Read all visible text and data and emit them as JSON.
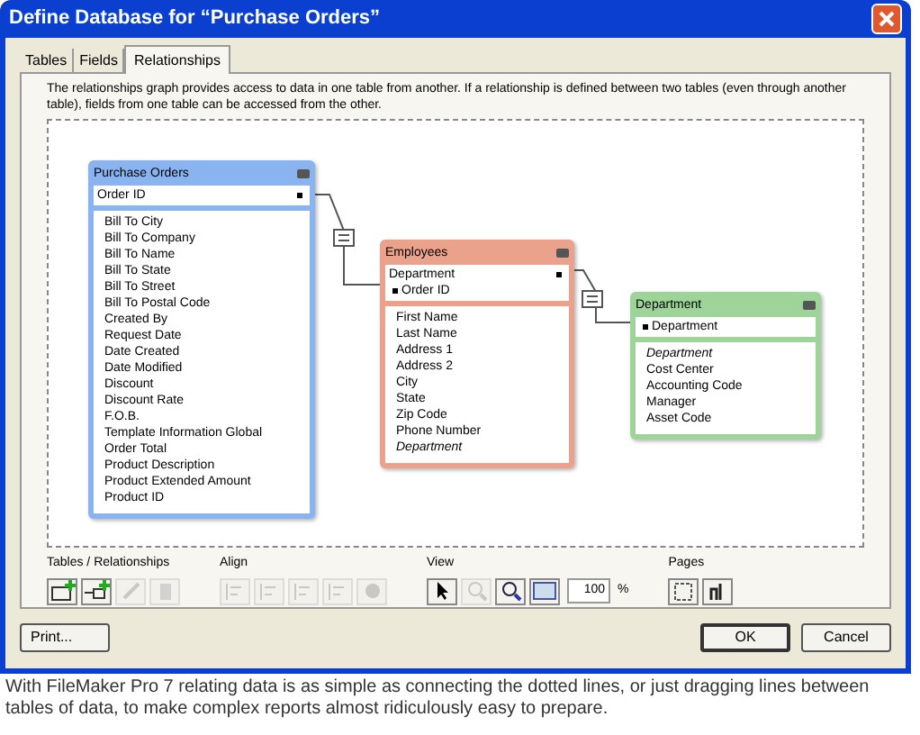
{
  "window": {
    "title": "Define Database for “Purchase Orders”"
  },
  "tabs": [
    {
      "label": "Tables",
      "selected": false
    },
    {
      "label": "Fields",
      "selected": false
    },
    {
      "label": "Relationships",
      "selected": true
    }
  ],
  "description": "The relationships graph provides access to data in one table from another. If a relationship is defined between two tables (even through another table), fields from one table can be accessed from the other.",
  "tables": [
    {
      "name": "Purchase Orders",
      "color": "#8ab4f0",
      "keys": [
        {
          "name": "Order ID",
          "kind": "right-link"
        }
      ],
      "fields": [
        {
          "name": "Bill To City",
          "italic": false
        },
        {
          "name": "Bill To Company",
          "italic": false
        },
        {
          "name": "Bill To Name",
          "italic": false
        },
        {
          "name": "Bill To State",
          "italic": false
        },
        {
          "name": "Bill To Street",
          "italic": false
        },
        {
          "name": "Bill To Postal Code",
          "italic": false
        },
        {
          "name": "Created By",
          "italic": false
        },
        {
          "name": "Request Date",
          "italic": false
        },
        {
          "name": "Date Created",
          "italic": false
        },
        {
          "name": "Date Modified",
          "italic": false
        },
        {
          "name": "Discount",
          "italic": false
        },
        {
          "name": "Discount Rate",
          "italic": false
        },
        {
          "name": "F.O.B.",
          "italic": false
        },
        {
          "name": "Template Information Global",
          "italic": false
        },
        {
          "name": "Order Total",
          "italic": false
        },
        {
          "name": "Product Description",
          "italic": false
        },
        {
          "name": "Product Extended Amount",
          "italic": false
        },
        {
          "name": "Product ID",
          "italic": false
        }
      ]
    },
    {
      "name": "Employees",
      "color": "#eaa28c",
      "keys": [
        {
          "name": "Department",
          "kind": "right-link"
        },
        {
          "name": "Order ID",
          "kind": "left-link"
        }
      ],
      "fields": [
        {
          "name": "First Name",
          "italic": false
        },
        {
          "name": "Last Name",
          "italic": false
        },
        {
          "name": "Address 1",
          "italic": false
        },
        {
          "name": "Address 2",
          "italic": false
        },
        {
          "name": "City",
          "italic": false
        },
        {
          "name": "State",
          "italic": false
        },
        {
          "name": "Zip Code",
          "italic": false
        },
        {
          "name": "Phone Number",
          "italic": false
        },
        {
          "name": "Department",
          "italic": true
        }
      ]
    },
    {
      "name": "Department",
      "color": "#9ed49a",
      "keys": [
        {
          "name": "Department",
          "kind": "left-link"
        }
      ],
      "fields": [
        {
          "name": "Department",
          "italic": true
        },
        {
          "name": "Cost Center",
          "italic": false
        },
        {
          "name": "Accounting Code",
          "italic": false
        },
        {
          "name": "Manager",
          "italic": false
        },
        {
          "name": "Asset Code",
          "italic": false
        }
      ]
    }
  ],
  "toolbar": [
    {
      "label": "Tables / Relationships",
      "buttons": [
        {
          "kind": "add-table",
          "disabled": false
        },
        {
          "kind": "add-relationship",
          "disabled": false
        },
        {
          "kind": "edit",
          "disabled": true
        },
        {
          "kind": "delete",
          "disabled": true
        }
      ]
    },
    {
      "label": "Align",
      "buttons": [
        {
          "kind": "align-left",
          "disabled": true
        },
        {
          "kind": "align-center",
          "disabled": true
        },
        {
          "kind": "align-top",
          "disabled": true
        },
        {
          "kind": "align-bottom",
          "disabled": true
        },
        {
          "kind": "color",
          "disabled": true
        }
      ]
    },
    {
      "label": "View",
      "buttons": [
        {
          "kind": "pointer",
          "disabled": false
        },
        {
          "kind": "zoom-in",
          "disabled": true
        },
        {
          "kind": "zoom-out",
          "disabled": false
        },
        {
          "kind": "fit",
          "disabled": false
        }
      ],
      "zoom": "100",
      "unit": "%"
    },
    {
      "label": "Pages",
      "buttons": [
        {
          "kind": "page-setup",
          "disabled": false
        },
        {
          "kind": "page-breaks",
          "disabled": false
        }
      ]
    }
  ],
  "buttons": {
    "print": "Print...",
    "ok": "OK",
    "cancel": "Cancel"
  },
  "caption": "With FileMaker Pro 7 relating data is as simple as connecting the dotted lines, or just dragging lines between tables of data, to make complex reports almost ridiculously easy to prepare."
}
